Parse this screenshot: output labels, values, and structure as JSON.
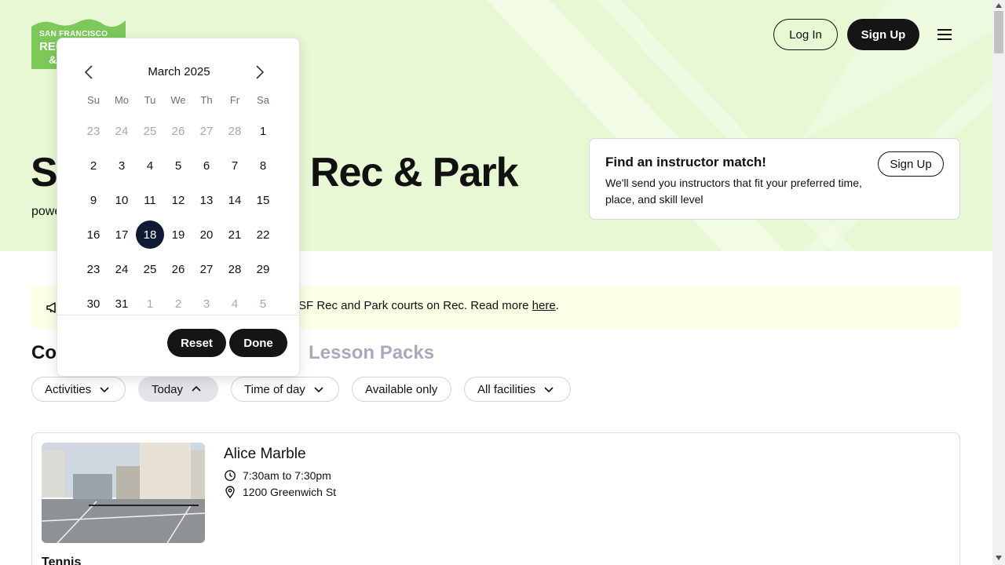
{
  "logo": {
    "line1": "SAN FRANCISCO",
    "line2": "REC",
    "line3": "&",
    "color": "#7cc95a"
  },
  "header": {
    "login_label": "Log In",
    "signup_label": "Sign Up"
  },
  "hero": {
    "title": "San Francisco Rec & Park",
    "subtitle": "powered by Rec",
    "background": "#e8f8d4"
  },
  "match_card": {
    "title": "Find an instructor match!",
    "text": "We'll send you instructors that fit your preferred time, place, and skill level",
    "button_label": "Sign Up"
  },
  "notice": {
    "text": "SF Rec and Park courts on Rec. Read more ",
    "link_text": "here",
    "suffix": "."
  },
  "tabs": {
    "courts": "Courts",
    "lesson_packs": "Lesson Packs"
  },
  "filters": {
    "activities": "Activities",
    "today": "Today",
    "time_of_day": "Time of day",
    "available_only": "Available only",
    "all_facilities": "All facilities"
  },
  "facility": {
    "name": "Alice Marble",
    "hours": "7:30am to 7:30pm",
    "address": "1200 Greenwich St",
    "sport": "Tennis"
  },
  "calendar": {
    "month_label": "March 2025",
    "weekdays": [
      "Su",
      "Mo",
      "Tu",
      "We",
      "Th",
      "Fr",
      "Sa"
    ],
    "days": [
      {
        "label": "23",
        "muted": true
      },
      {
        "label": "24",
        "muted": true
      },
      {
        "label": "25",
        "muted": true
      },
      {
        "label": "26",
        "muted": true
      },
      {
        "label": "27",
        "muted": true
      },
      {
        "label": "28",
        "muted": true
      },
      {
        "label": "1"
      },
      {
        "label": "2"
      },
      {
        "label": "3"
      },
      {
        "label": "4"
      },
      {
        "label": "5"
      },
      {
        "label": "6"
      },
      {
        "label": "7"
      },
      {
        "label": "8"
      },
      {
        "label": "9"
      },
      {
        "label": "10"
      },
      {
        "label": "11"
      },
      {
        "label": "12"
      },
      {
        "label": "13"
      },
      {
        "label": "14"
      },
      {
        "label": "15"
      },
      {
        "label": "16"
      },
      {
        "label": "17"
      },
      {
        "label": "18",
        "selected": true
      },
      {
        "label": "19"
      },
      {
        "label": "20"
      },
      {
        "label": "21"
      },
      {
        "label": "22"
      },
      {
        "label": "23"
      },
      {
        "label": "24"
      },
      {
        "label": "25"
      },
      {
        "label": "26"
      },
      {
        "label": "27"
      },
      {
        "label": "28"
      },
      {
        "label": "29"
      },
      {
        "label": "30"
      },
      {
        "label": "31"
      },
      {
        "label": "1",
        "muted": true
      },
      {
        "label": "2",
        "muted": true
      },
      {
        "label": "3",
        "muted": true
      },
      {
        "label": "4",
        "muted": true
      },
      {
        "label": "5",
        "muted": true
      }
    ],
    "selected_color": "#0f1a33",
    "reset_label": "Reset",
    "done_label": "Done"
  }
}
